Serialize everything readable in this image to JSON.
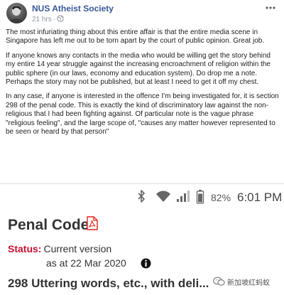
{
  "post": {
    "page_name": "NUS Atheist Society",
    "timestamp": "21 hrs",
    "separator": "·",
    "more_icon": "ellipsis-icon",
    "paragraphs": [
      "The most infuriating thing about this entire affair is that the entire media scene in Singapore has left me out to be torn apart by the court of public opinion. Great job.",
      "If anyone knows any contacts in the media who would be willing get the story behind my entire 14 year struggle against the increasing encroachment of religion within the public sphere (in our laws, economy and education system). Do drop me a note. Perhaps the story may not be published, but at least I need to get it off my chest.",
      "In any case, if anyone is interested in the offence I'm being investigated for, it is section 298 of the penal code. This is exactly the kind of discriminatory law against the non-religious that I had been fighting against. Of particular note is the vague phrase \"religious feeling\", and the large scope of, \"causes any matter however represented to be seen or heard by that person\""
    ]
  },
  "statusbar": {
    "battery_percent": "82%",
    "time": "6:01 PM"
  },
  "penal_code": {
    "title": "Penal Code",
    "status_label": "Status:",
    "status_value": "Current version",
    "as_at": "as at 22 Mar 2020",
    "section_title": "298 Uttering words, etc., with deli..."
  },
  "watermark": {
    "text": "新加坡红蚂蚁"
  },
  "colors": {
    "link_blue": "#385898",
    "status_red": "#c8102e",
    "text": "#1c1e21",
    "meta_gray": "#90949c"
  }
}
